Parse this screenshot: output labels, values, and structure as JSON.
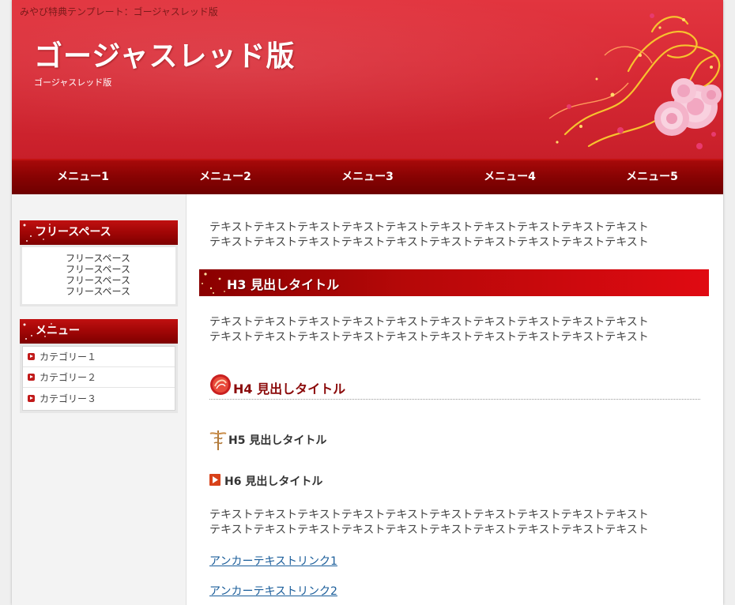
{
  "page": {
    "background": "#efefef",
    "accent": "#c81f2a"
  },
  "header": {
    "tagline": "みやび特典テンプレート：ゴージャスレッド版",
    "title": "ゴージャスレッド版",
    "description": "ゴージャスレッド版"
  },
  "nav": {
    "items": [
      {
        "label": "メニュー1"
      },
      {
        "label": "メニュー2"
      },
      {
        "label": "メニュー3"
      },
      {
        "label": "メニュー4"
      },
      {
        "label": "メニュー5"
      }
    ]
  },
  "sidebar": {
    "free_space": {
      "heading": "フリースペース",
      "lines": [
        "フリースペース",
        "フリースペース",
        "フリースペース",
        "フリースペース"
      ]
    },
    "menu": {
      "heading": "メニュー",
      "items": [
        {
          "label": "カテゴリー１",
          "icon": "arrow-right-icon"
        },
        {
          "label": "カテゴリー２",
          "icon": "arrow-right-icon"
        },
        {
          "label": "カテゴリー３",
          "icon": "arrow-right-icon"
        }
      ]
    }
  },
  "main": {
    "para1": [
      "テキストテキストテキストテキストテキストテキストテキストテキストテキストテキスト",
      "テキストテキストテキストテキストテキストテキストテキストテキストテキストテキスト"
    ],
    "h3": "H3 見出しタイトル",
    "para2": [
      "テキストテキストテキストテキストテキストテキストテキストテキストテキストテキスト",
      "テキストテキストテキストテキストテキストテキストテキストテキストテキストテキスト"
    ],
    "h4": "H4 見出しタイトル",
    "h5": "H5 見出しタイトル",
    "h6": "H6 見出しタイトル",
    "para3": [
      "テキストテキストテキストテキストテキストテキストテキストテキストテキストテキスト",
      "テキストテキストテキストテキストテキストテキストテキストテキストテキストテキスト"
    ],
    "links": [
      "アンカーテキストリンク1",
      "アンカーテキストリンク2"
    ]
  }
}
